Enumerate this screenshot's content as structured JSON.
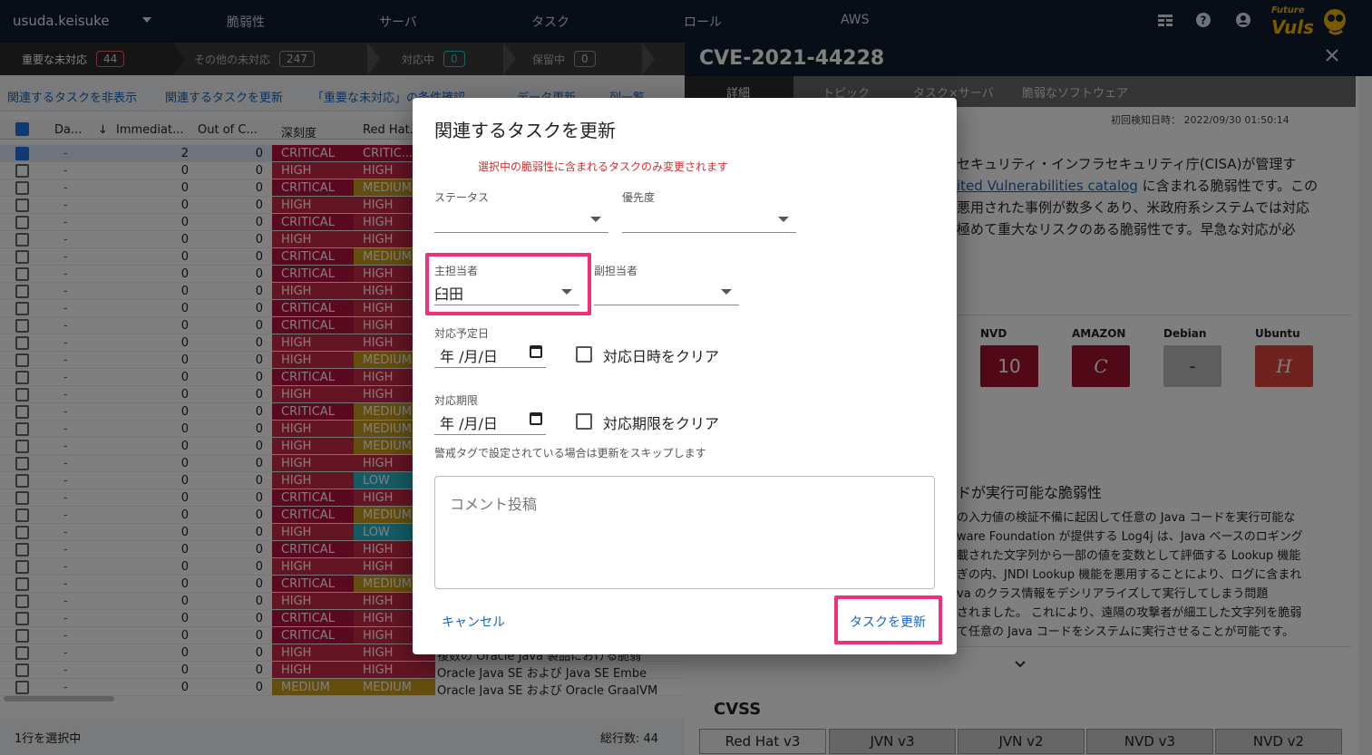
{
  "topbar": {
    "user": "usuda.keisuke",
    "nav": [
      "脆弱性",
      "サーバ",
      "タスク",
      "ロール",
      "AWS"
    ],
    "icons": [
      "table-icon",
      "help-icon",
      "account-icon"
    ],
    "logo_top": "Future",
    "logo_main": "Vuls"
  },
  "vuln_tabs": [
    {
      "label": "重要な未対応",
      "count": "44"
    },
    {
      "label": "その他の未対応",
      "count": "247"
    },
    {
      "label": "対応中",
      "count": "0"
    },
    {
      "label": "保留中",
      "count": "0"
    }
  ],
  "toolbar": {
    "hide_tasks": "関連するタスクを非表示",
    "update_tasks": "関連するタスクを更新",
    "condition": "「重要な未対応」の条件確認",
    "data_update": "データ更新",
    "columns": "列一覧"
  },
  "table": {
    "headers": [
      "Da...",
      "Immediat...",
      "Out of C...",
      "深刻度",
      "Red Hat..."
    ],
    "rows": [
      {
        "da": "-",
        "imm": "2",
        "ooc": "0",
        "sev": "CRITICAL",
        "rh": "CRITIC...",
        "title": "",
        "selected": true
      },
      {
        "da": "-",
        "imm": "0",
        "ooc": "0",
        "sev": "HIGH",
        "rh": "HIGH",
        "title": ""
      },
      {
        "da": "-",
        "imm": "0",
        "ooc": "0",
        "sev": "CRITICAL",
        "rh": "MEDIUM",
        "title": ""
      },
      {
        "da": "-",
        "imm": "0",
        "ooc": "0",
        "sev": "HIGH",
        "rh": "HIGH",
        "title": ""
      },
      {
        "da": "-",
        "imm": "0",
        "ooc": "0",
        "sev": "CRITICAL",
        "rh": "HIGH",
        "title": ""
      },
      {
        "da": "-",
        "imm": "0",
        "ooc": "0",
        "sev": "HIGH",
        "rh": "HIGH",
        "title": ""
      },
      {
        "da": "-",
        "imm": "0",
        "ooc": "0",
        "sev": "CRITICAL",
        "rh": "MEDIUM",
        "title": ""
      },
      {
        "da": "-",
        "imm": "0",
        "ooc": "0",
        "sev": "CRITICAL",
        "rh": "HIGH",
        "title": ""
      },
      {
        "da": "-",
        "imm": "0",
        "ooc": "0",
        "sev": "HIGH",
        "rh": "HIGH",
        "title": ""
      },
      {
        "da": "-",
        "imm": "0",
        "ooc": "0",
        "sev": "CRITICAL",
        "rh": "HIGH",
        "title": ""
      },
      {
        "da": "-",
        "imm": "0",
        "ooc": "0",
        "sev": "CRITICAL",
        "rh": "HIGH",
        "title": ""
      },
      {
        "da": "-",
        "imm": "0",
        "ooc": "0",
        "sev": "HIGH",
        "rh": "HIGH",
        "title": ""
      },
      {
        "da": "-",
        "imm": "0",
        "ooc": "0",
        "sev": "HIGH",
        "rh": "MEDIUM",
        "title": ""
      },
      {
        "da": "-",
        "imm": "0",
        "ooc": "0",
        "sev": "CRITICAL",
        "rh": "HIGH",
        "title": ""
      },
      {
        "da": "-",
        "imm": "0",
        "ooc": "0",
        "sev": "HIGH",
        "rh": "HIGH",
        "title": ""
      },
      {
        "da": "-",
        "imm": "0",
        "ooc": "0",
        "sev": "CRITICAL",
        "rh": "MEDIUM",
        "title": ""
      },
      {
        "da": "-",
        "imm": "0",
        "ooc": "0",
        "sev": "HIGH",
        "rh": "MEDIUM",
        "title": ""
      },
      {
        "da": "-",
        "imm": "0",
        "ooc": "0",
        "sev": "HIGH",
        "rh": "MEDIUM",
        "title": ""
      },
      {
        "da": "-",
        "imm": "0",
        "ooc": "0",
        "sev": "HIGH",
        "rh": "HIGH",
        "title": ""
      },
      {
        "da": "-",
        "imm": "0",
        "ooc": "0",
        "sev": "HIGH",
        "rh": "LOW",
        "title": ""
      },
      {
        "da": "-",
        "imm": "0",
        "ooc": "0",
        "sev": "CRITICAL",
        "rh": "HIGH",
        "title": ""
      },
      {
        "da": "-",
        "imm": "0",
        "ooc": "0",
        "sev": "CRITICAL",
        "rh": "MEDIUM",
        "title": ""
      },
      {
        "da": "-",
        "imm": "0",
        "ooc": "0",
        "sev": "HIGH",
        "rh": "LOW",
        "title": ""
      },
      {
        "da": "-",
        "imm": "0",
        "ooc": "0",
        "sev": "CRITICAL",
        "rh": "HIGH",
        "title": ""
      },
      {
        "da": "-",
        "imm": "0",
        "ooc": "0",
        "sev": "HIGH",
        "rh": "HIGH",
        "title": ""
      },
      {
        "da": "-",
        "imm": "0",
        "ooc": "0",
        "sev": "CRITICAL",
        "rh": "MEDIUM",
        "title": ""
      },
      {
        "da": "-",
        "imm": "0",
        "ooc": "0",
        "sev": "HIGH",
        "rh": "HIGH",
        "title": ""
      },
      {
        "da": "-",
        "imm": "0",
        "ooc": "0",
        "sev": "CRITICAL",
        "rh": "HIGH",
        "title": ""
      },
      {
        "da": "-",
        "imm": "0",
        "ooc": "0",
        "sev": "CRITICAL",
        "rh": "HIGH",
        "title": ""
      },
      {
        "da": "-",
        "imm": "0",
        "ooc": "0",
        "sev": "HIGH",
        "rh": "HIGH",
        "title": "複数の Oracle Java 製品における脆弱"
      },
      {
        "da": "-",
        "imm": "0",
        "ooc": "0",
        "sev": "HIGH",
        "rh": "HIGH",
        "title": "Oracle Java SE および Java SE Embe"
      },
      {
        "da": "-",
        "imm": "0",
        "ooc": "0",
        "sev": "MEDIUM",
        "rh": "MEDIUM",
        "title": "Oracle Java SE および Oracle GraalVM"
      }
    ]
  },
  "footer": {
    "selected": "1行を選択中",
    "total": "総行数: 44"
  },
  "detail": {
    "cve": "CVE-2021-44228",
    "tabs": [
      "詳細",
      "トピック",
      "タスク×サーバ",
      "脆弱なソフトウェア"
    ],
    "first_detected": "初回検知日時： 2022/09/30 01:50:14",
    "desc_lines": [
      "セキュリティ・インフラセキュリティ庁(CISA)が管理す",
      "ited Vulnerabilities catalog",
      " に含まれる脆弱性です。この",
      "悪用された事例が数多くあり、米政府系システムでは対応",
      "極めて重大なリスクのある脆弱性です。早急な対応が必"
    ],
    "scores": [
      {
        "source": "NVD",
        "value": "10"
      },
      {
        "source": "AMAZON",
        "value": "C"
      },
      {
        "source": "Debian",
        "value": "-"
      },
      {
        "source": "Ubuntu",
        "value": "H"
      }
    ],
    "summary_title": "ドが実行可能な脆弱性",
    "summary_lines": [
      "の入力値の検証不備に起因して任意の Java コードを実行可能な",
      "ware Foundation が提供する Log4j は、Java ベースのロギング",
      "載された文字列から一部の値を変数として評価する Lookup 機能",
      "ぎの内、JNDI Lookup 機能を悪用することにより、ログに含まれ",
      "va のクラス情報をデシリアライズして実行してしまう問題",
      "されました。 これにより、遠隔の攻撃者が細工した文字列を脆弱",
      "て任意の Java コードをシステムに実行させることが可能です。"
    ],
    "cvss_title": "CVSS",
    "cvss_tabs": [
      "Red Hat v3",
      "JVN v3",
      "JVN v2",
      "NVD v3",
      "NVD v2"
    ]
  },
  "dialog": {
    "title": "関連するタスクを更新",
    "warning": "選択中の脆弱性に含まれるタスクのみ変更されます",
    "status_label": "ステータス",
    "status_value": "",
    "priority_label": "優先度",
    "priority_value": "",
    "main_assignee_label": "主担当者",
    "main_assignee_value": "臼田",
    "sub_assignee_label": "副担当者",
    "sub_assignee_value": "",
    "due_plan_label": "対応予定日",
    "due_plan_value": "年 /月/日",
    "clear_plan_label": "対応日時をクリア",
    "deadline_label": "対応期限",
    "deadline_value": "年 /月/日",
    "clear_deadline_label": "対応期限をクリア",
    "note": "警戒タグで設定されている場合は更新をスキップします",
    "comment_placeholder": "コメント投稿",
    "cancel": "キャンセル",
    "submit": "タスクを更新"
  },
  "colors": {
    "critical": "#b5123f",
    "high": "#c92a47",
    "medium": "#c79a1f",
    "low": "#2ab7c9",
    "highlight": "#f0307a",
    "link": "#1565c0"
  }
}
